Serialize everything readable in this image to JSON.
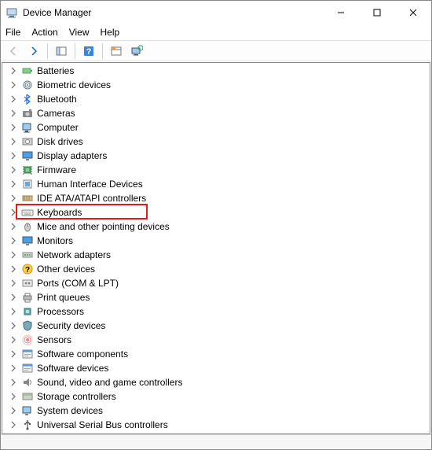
{
  "window": {
    "title": "Device Manager"
  },
  "menubar": {
    "items": [
      "File",
      "Action",
      "View",
      "Help"
    ]
  },
  "toolbar": {
    "buttons": [
      {
        "name": "back-icon"
      },
      {
        "name": "forward-icon"
      },
      {
        "name": "sep"
      },
      {
        "name": "show-hide-tree-icon"
      },
      {
        "name": "sep"
      },
      {
        "name": "help-icon"
      },
      {
        "name": "sep"
      },
      {
        "name": "properties-icon"
      },
      {
        "name": "computer-icon"
      }
    ]
  },
  "highlight": {
    "category_index": 10
  },
  "tree": {
    "categories": [
      {
        "label": "Batteries",
        "icon": "battery-icon"
      },
      {
        "label": "Biometric devices",
        "icon": "fingerprint-icon"
      },
      {
        "label": "Bluetooth",
        "icon": "bluetooth-icon"
      },
      {
        "label": "Cameras",
        "icon": "camera-icon"
      },
      {
        "label": "Computer",
        "icon": "pc-icon"
      },
      {
        "label": "Disk drives",
        "icon": "disk-icon"
      },
      {
        "label": "Display adapters",
        "icon": "display-icon"
      },
      {
        "label": "Firmware",
        "icon": "chip-icon"
      },
      {
        "label": "Human Interface Devices",
        "icon": "hid-icon"
      },
      {
        "label": "IDE ATA/ATAPI controllers",
        "icon": "ide-icon"
      },
      {
        "label": "Keyboards",
        "icon": "keyboard-icon"
      },
      {
        "label": "Mice and other pointing devices",
        "icon": "mouse-icon"
      },
      {
        "label": "Monitors",
        "icon": "monitor-icon"
      },
      {
        "label": "Network adapters",
        "icon": "network-icon"
      },
      {
        "label": "Other devices",
        "icon": "unknown-icon"
      },
      {
        "label": "Ports (COM & LPT)",
        "icon": "ports-icon"
      },
      {
        "label": "Print queues",
        "icon": "printer-icon"
      },
      {
        "label": "Processors",
        "icon": "cpu-icon"
      },
      {
        "label": "Security devices",
        "icon": "security-icon"
      },
      {
        "label": "Sensors",
        "icon": "sensor-icon"
      },
      {
        "label": "Software components",
        "icon": "software-icon"
      },
      {
        "label": "Software devices",
        "icon": "software-icon"
      },
      {
        "label": "Sound, video and game controllers",
        "icon": "audio-icon"
      },
      {
        "label": "Storage controllers",
        "icon": "storage-icon"
      },
      {
        "label": "System devices",
        "icon": "system-icon"
      },
      {
        "label": "Universal Serial Bus controllers",
        "icon": "usb-icon"
      }
    ]
  }
}
